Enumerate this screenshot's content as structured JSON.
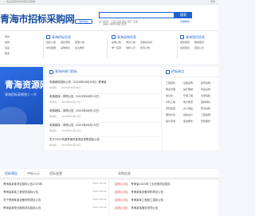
{
  "topbar": {
    "left_text": "欢迎来到青海市招标采购网",
    "right_text": "登录"
  },
  "header": {
    "logo": "青海市招标采购网",
    "logo_sub": "www.",
    "publish_btn": "发布信息",
    "search_placeholder": "请输入关键词进行搜索",
    "search_btn": "搜索",
    "advanced": "高级搜索",
    "hotwords": "热门搜索：工程  设备  物业  医疗  监理"
  },
  "nav": {
    "left_items": [
      "省份",
      "城市",
      "区县",
      "更多"
    ],
    "col1": {
      "title": "青海招标信息",
      "rows": [
        [
          "招标公告",
          "招标预告",
          "变更公告"
        ],
        [
          "中标结果",
          "采购信息",
          "业主委托"
        ]
      ]
    },
    "col2": {
      "title": "青海采购信息",
      "rows": [
        [
          "采购公告",
          "询价公告",
          "竞争性谈判"
        ],
        [
          "单一来源",
          "中标公示",
          "合同公告"
        ]
      ]
    },
    "col3": {
      "title": "青海项目信息",
      "rows": [
        [
          "拟建项目",
          "审批项目"
        ],
        [
          "在建项目",
          "项目公示"
        ]
      ]
    }
  },
  "banner": {
    "big": "青海资源网",
    "small": "青海招标采购快人一步"
  },
  "news": {
    "title": "青海市热门招标",
    "items": [
      {
        "tag": "1",
        "title": "电梯维保招标公告（2025年06月18日）青海省",
        "loc": "青海省",
        "date": "2025年06月18日"
      },
      {
        "tag": "2",
        "title": "电梯维保…采购公告（2025年06月12日）",
        "loc": "青海省",
        "date": "2025年06月12日"
      },
      {
        "tag": "3",
        "title": "电梯维保…采购公告（2025年06月12日）",
        "loc": "青海省",
        "date": "2025年06月12日"
      },
      {
        "tag": "4",
        "title": "电梯维保…采购公告（2025年06月12日）",
        "loc": "青海省",
        "date": "2025年06月12日"
      },
      {
        "tag": "5",
        "title": "关于2025年度青海市某项目采购招标公告",
        "loc": "青海省",
        "date": "2025年06月15日"
      }
    ]
  },
  "categories": {
    "title": "招标热点",
    "items": [
      "工程招标",
      "设备采购",
      "政府采购",
      "物业管理",
      "医疗器械",
      "药品采购",
      "信息化",
      "环保工程",
      "交通运输",
      "水利工程",
      "电力能源",
      "园林绿化",
      "安防监控",
      "办公用品",
      "家具采购",
      "服务外包",
      "勘察设计",
      "工程监理",
      "造价咨询",
      "保洁服务",
      "安保服务"
    ]
  },
  "tabs": [
    "招标预告",
    "中标公示",
    "招标变更",
    "采购信息"
  ],
  "list_left": [
    {
      "text": "青海省某某项目招标公告2025年",
      "date": "2025-06-18"
    },
    {
      "text": "青海省某某工程采购招标公告",
      "date": "2025-06-18"
    },
    {
      "text": "关于青海某某设备采购项目公告",
      "date": "2025-06-18"
    },
    {
      "text": "青海某某物业服务项目招标公告",
      "date": "2025-06-18"
    }
  ],
  "list_right": [
    {
      "tag": "【招标公告】",
      "text": "青海省2025年工业改造项目招标",
      "date": "2025-06-18"
    },
    {
      "tag": "【招标公告】",
      "text": "青海某某设备采购项目公告",
      "date": "2025-06-18"
    },
    {
      "tag": "【招标公告】",
      "text": "青海某某工程施工招标公告",
      "date": "2025-06-18"
    },
    {
      "tag": "【招标公告】",
      "text": "青海某某服务采购公告",
      "date": "2025-06-18"
    }
  ],
  "colors": {
    "primary": "#1e62d0",
    "tag": "#e05050"
  }
}
